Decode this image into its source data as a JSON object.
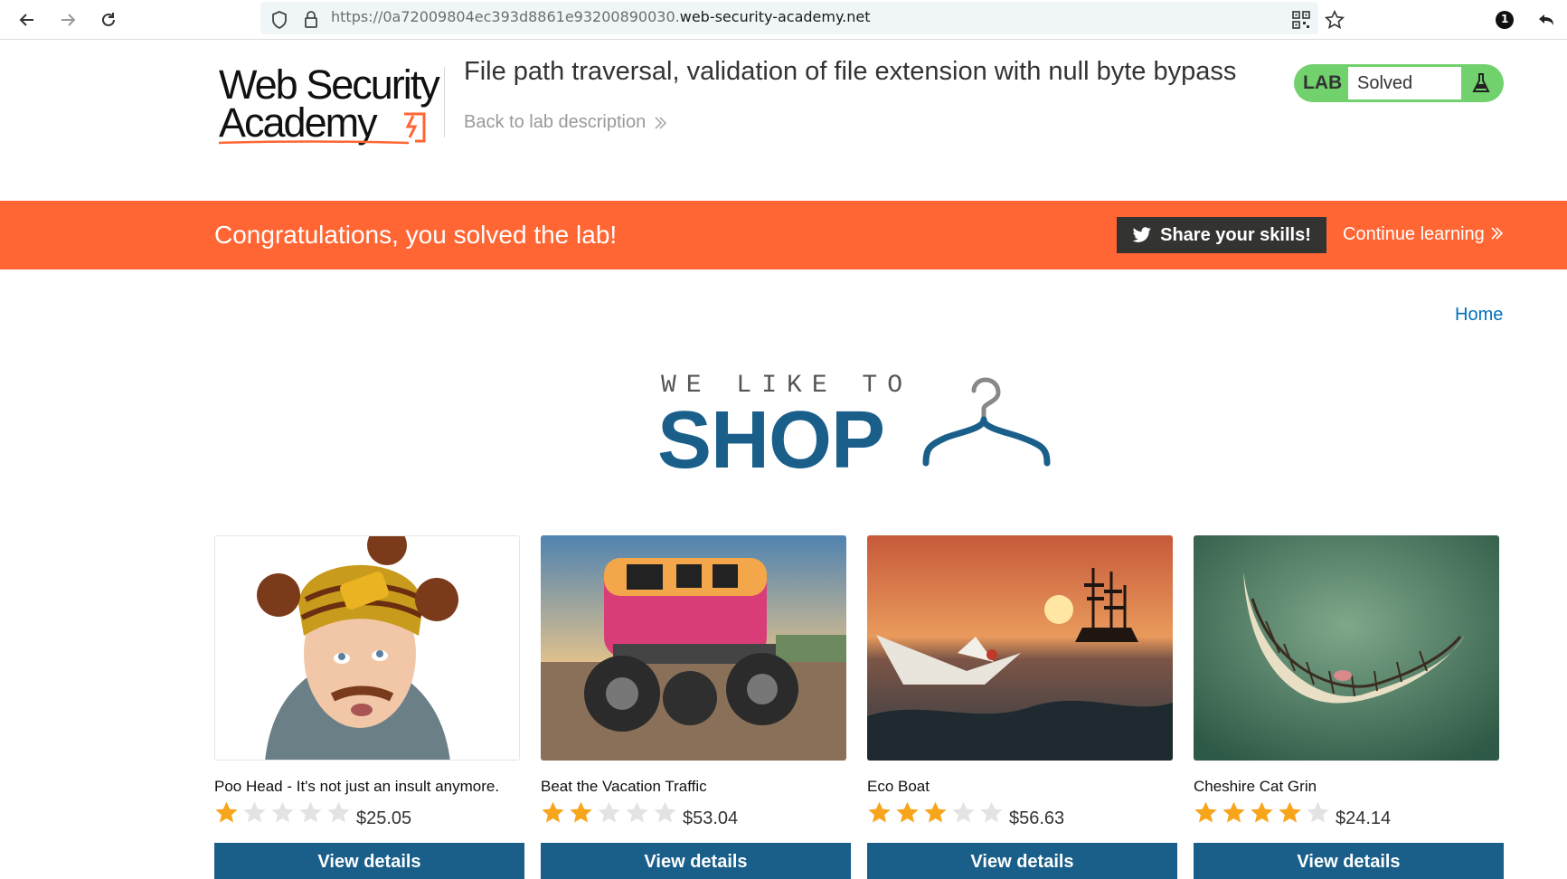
{
  "browser": {
    "url_prefix": "https://0a72009804ec393d8861e93200890030.",
    "url_host": "web-security-academy.net",
    "notification_count": "1"
  },
  "header": {
    "logo_line1": "Web Security",
    "logo_line2": "Academy",
    "lab_title": "File path traversal, validation of file extension with null byte bypass",
    "back_link": "Back to lab description",
    "lab_tag": "LAB",
    "lab_status": "Solved"
  },
  "banner": {
    "message": "Congratulations, you solved the lab!",
    "share_label": "Share your skills!",
    "continue_label": "Continue learning"
  },
  "nav": {
    "home": "Home"
  },
  "shop": {
    "tagline": "WE LIKE TO",
    "title": "SHOP"
  },
  "products": [
    {
      "name": "Poo Head - It's not just an insult anymore.",
      "rating": 1,
      "price": "$25.05",
      "button": "View details"
    },
    {
      "name": "Beat the Vacation Traffic",
      "rating": 2,
      "price": "$53.04",
      "button": "View details"
    },
    {
      "name": "Eco Boat",
      "rating": 3,
      "price": "$56.63",
      "button": "View details"
    },
    {
      "name": "Cheshire Cat Grin",
      "rating": 4,
      "price": "$24.14",
      "button": "View details"
    }
  ],
  "colors": {
    "banner": "#ff6633",
    "brand_blue": "#1a5f8a",
    "lab_green": "#70d16d",
    "star_filled": "#f7a51d",
    "star_empty": "#e3e3e3"
  }
}
